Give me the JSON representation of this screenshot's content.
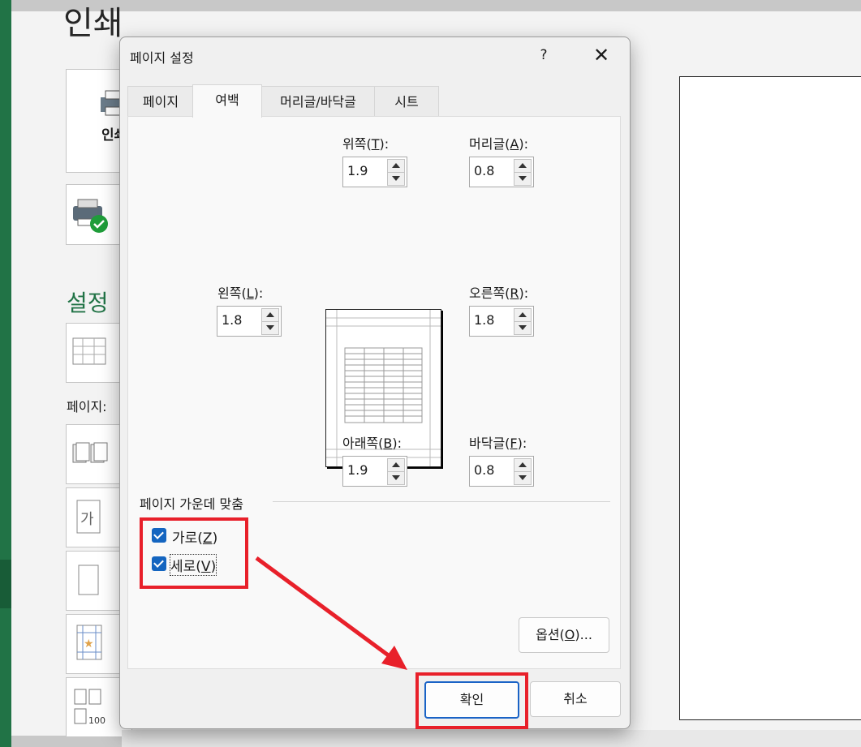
{
  "background": {
    "title": "인쇄",
    "print_button_label": "인쇄",
    "settings_heading": "설정",
    "pages_label": "페이지:"
  },
  "dialog": {
    "title": "페이지 설정",
    "help": "?",
    "close": "✕",
    "tabs": [
      {
        "label": "페이지",
        "active": false
      },
      {
        "label": "여백",
        "active": true
      },
      {
        "label": "머리글/바닥글",
        "active": false
      },
      {
        "label": "시트",
        "active": false
      }
    ],
    "margins": {
      "top": {
        "label": "위쪽",
        "key": "T",
        "value": "1.9"
      },
      "header": {
        "label": "머리글",
        "key": "A",
        "value": "0.8"
      },
      "left": {
        "label": "왼쪽",
        "key": "L",
        "value": "1.8"
      },
      "right": {
        "label": "오른쪽",
        "key": "R",
        "value": "1.8"
      },
      "bottom": {
        "label": "아래쪽",
        "key": "B",
        "value": "1.9"
      },
      "footer": {
        "label": "바닥글",
        "key": "F",
        "value": "0.8"
      }
    },
    "center_on_page": {
      "label": "페이지 가운데 맞춤",
      "horizontal": {
        "label": "가로",
        "key": "Z",
        "checked": true
      },
      "vertical": {
        "label": "세로",
        "key": "V",
        "checked": true
      }
    },
    "options_button": {
      "label": "옵션",
      "key": "O",
      "suffix": "..."
    },
    "ok_label": "확인",
    "cancel_label": "취소"
  },
  "annotations": {
    "highlight_color": "#e8202a"
  }
}
